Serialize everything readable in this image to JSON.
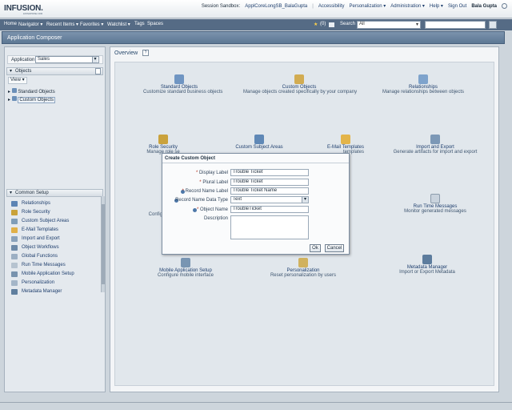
{
  "header": {
    "logo": "INFUSION.",
    "logo_sub": "ENTERPRISE CRM",
    "session_prefix": "Session Sandbox:",
    "session_link": "ApplCoreLongSB_BalaGupta",
    "accessibility": "Accessibility",
    "personalization": "Personalization",
    "administration": "Administration",
    "help": "Help",
    "signout": "Sign Out",
    "username": "Bala Gupta"
  },
  "nav": {
    "home": "Home",
    "navigator": "Navigator",
    "recent": "Recent Items",
    "favorites": "Favorites",
    "watchlist": "Watchlist",
    "tags": "Tags",
    "spaces": "Spaces",
    "count": "(0)",
    "search_label": "Search",
    "search_scope": "All",
    "search_value": ""
  },
  "app": {
    "title": "Application Composer"
  },
  "left": {
    "application_label": "Application",
    "application_value": "Sales",
    "objects_title": "Objects",
    "view_label": "View",
    "tree": [
      "Standard Objects",
      "Custom Objects"
    ],
    "common_setup_title": "Common Setup",
    "setup_items": [
      "Relationships",
      "Role Security",
      "Custom Subject Areas",
      "E-Mail Templates",
      "Import and Export",
      "Object Workflows",
      "Global Functions",
      "Run Time Messages",
      "Mobile Application Setup",
      "Personalization",
      "Metadata Manager"
    ]
  },
  "overview": {
    "title": "Overview",
    "help": "?",
    "tiles": [
      {
        "title": "Standard Objects",
        "desc": "Customize standard business objects"
      },
      {
        "title": "Custom Objects",
        "desc": "Manage objects created specifically by your company"
      },
      {
        "title": "Relationships",
        "desc": "Manage relationships between objects"
      },
      {
        "title": "Role Security",
        "desc": "Manage role se"
      },
      {
        "title": "Custom Subject Areas",
        "desc": ""
      },
      {
        "title": "E-Mail Templates",
        "desc": "templates"
      },
      {
        "title": "Import and Export",
        "desc": "Generate artifacts for import and export"
      },
      {
        "title": "",
        "desc": "Configur"
      },
      {
        "title": "Run Time Messages",
        "desc": "Monitor generated messages"
      },
      {
        "title": "Mobile Application Setup",
        "desc": "Configure mobile interface"
      },
      {
        "title": "Personalization",
        "desc": "Reset personalization by users"
      },
      {
        "title": "Metadata Manager",
        "desc": "Import or Export Metadata"
      }
    ]
  },
  "dialog": {
    "title": "Create Custom Object",
    "fields": [
      {
        "label": "Display Label",
        "value": "Trouble Ticket",
        "required": "*"
      },
      {
        "label": "Plural Label",
        "value": "Trouble Ticket",
        "required": "*"
      },
      {
        "label": "Record Name Label",
        "value": "Trouble Ticket Name",
        "required": "*"
      },
      {
        "label": "Record Name Data Type",
        "value": "Text",
        "required": ""
      },
      {
        "label": "Object Name",
        "value": "TroubleTicket",
        "required": "*"
      },
      {
        "label": "Description",
        "value": "",
        "required": ""
      }
    ],
    "ok": "Ok",
    "cancel": "Cancel"
  }
}
